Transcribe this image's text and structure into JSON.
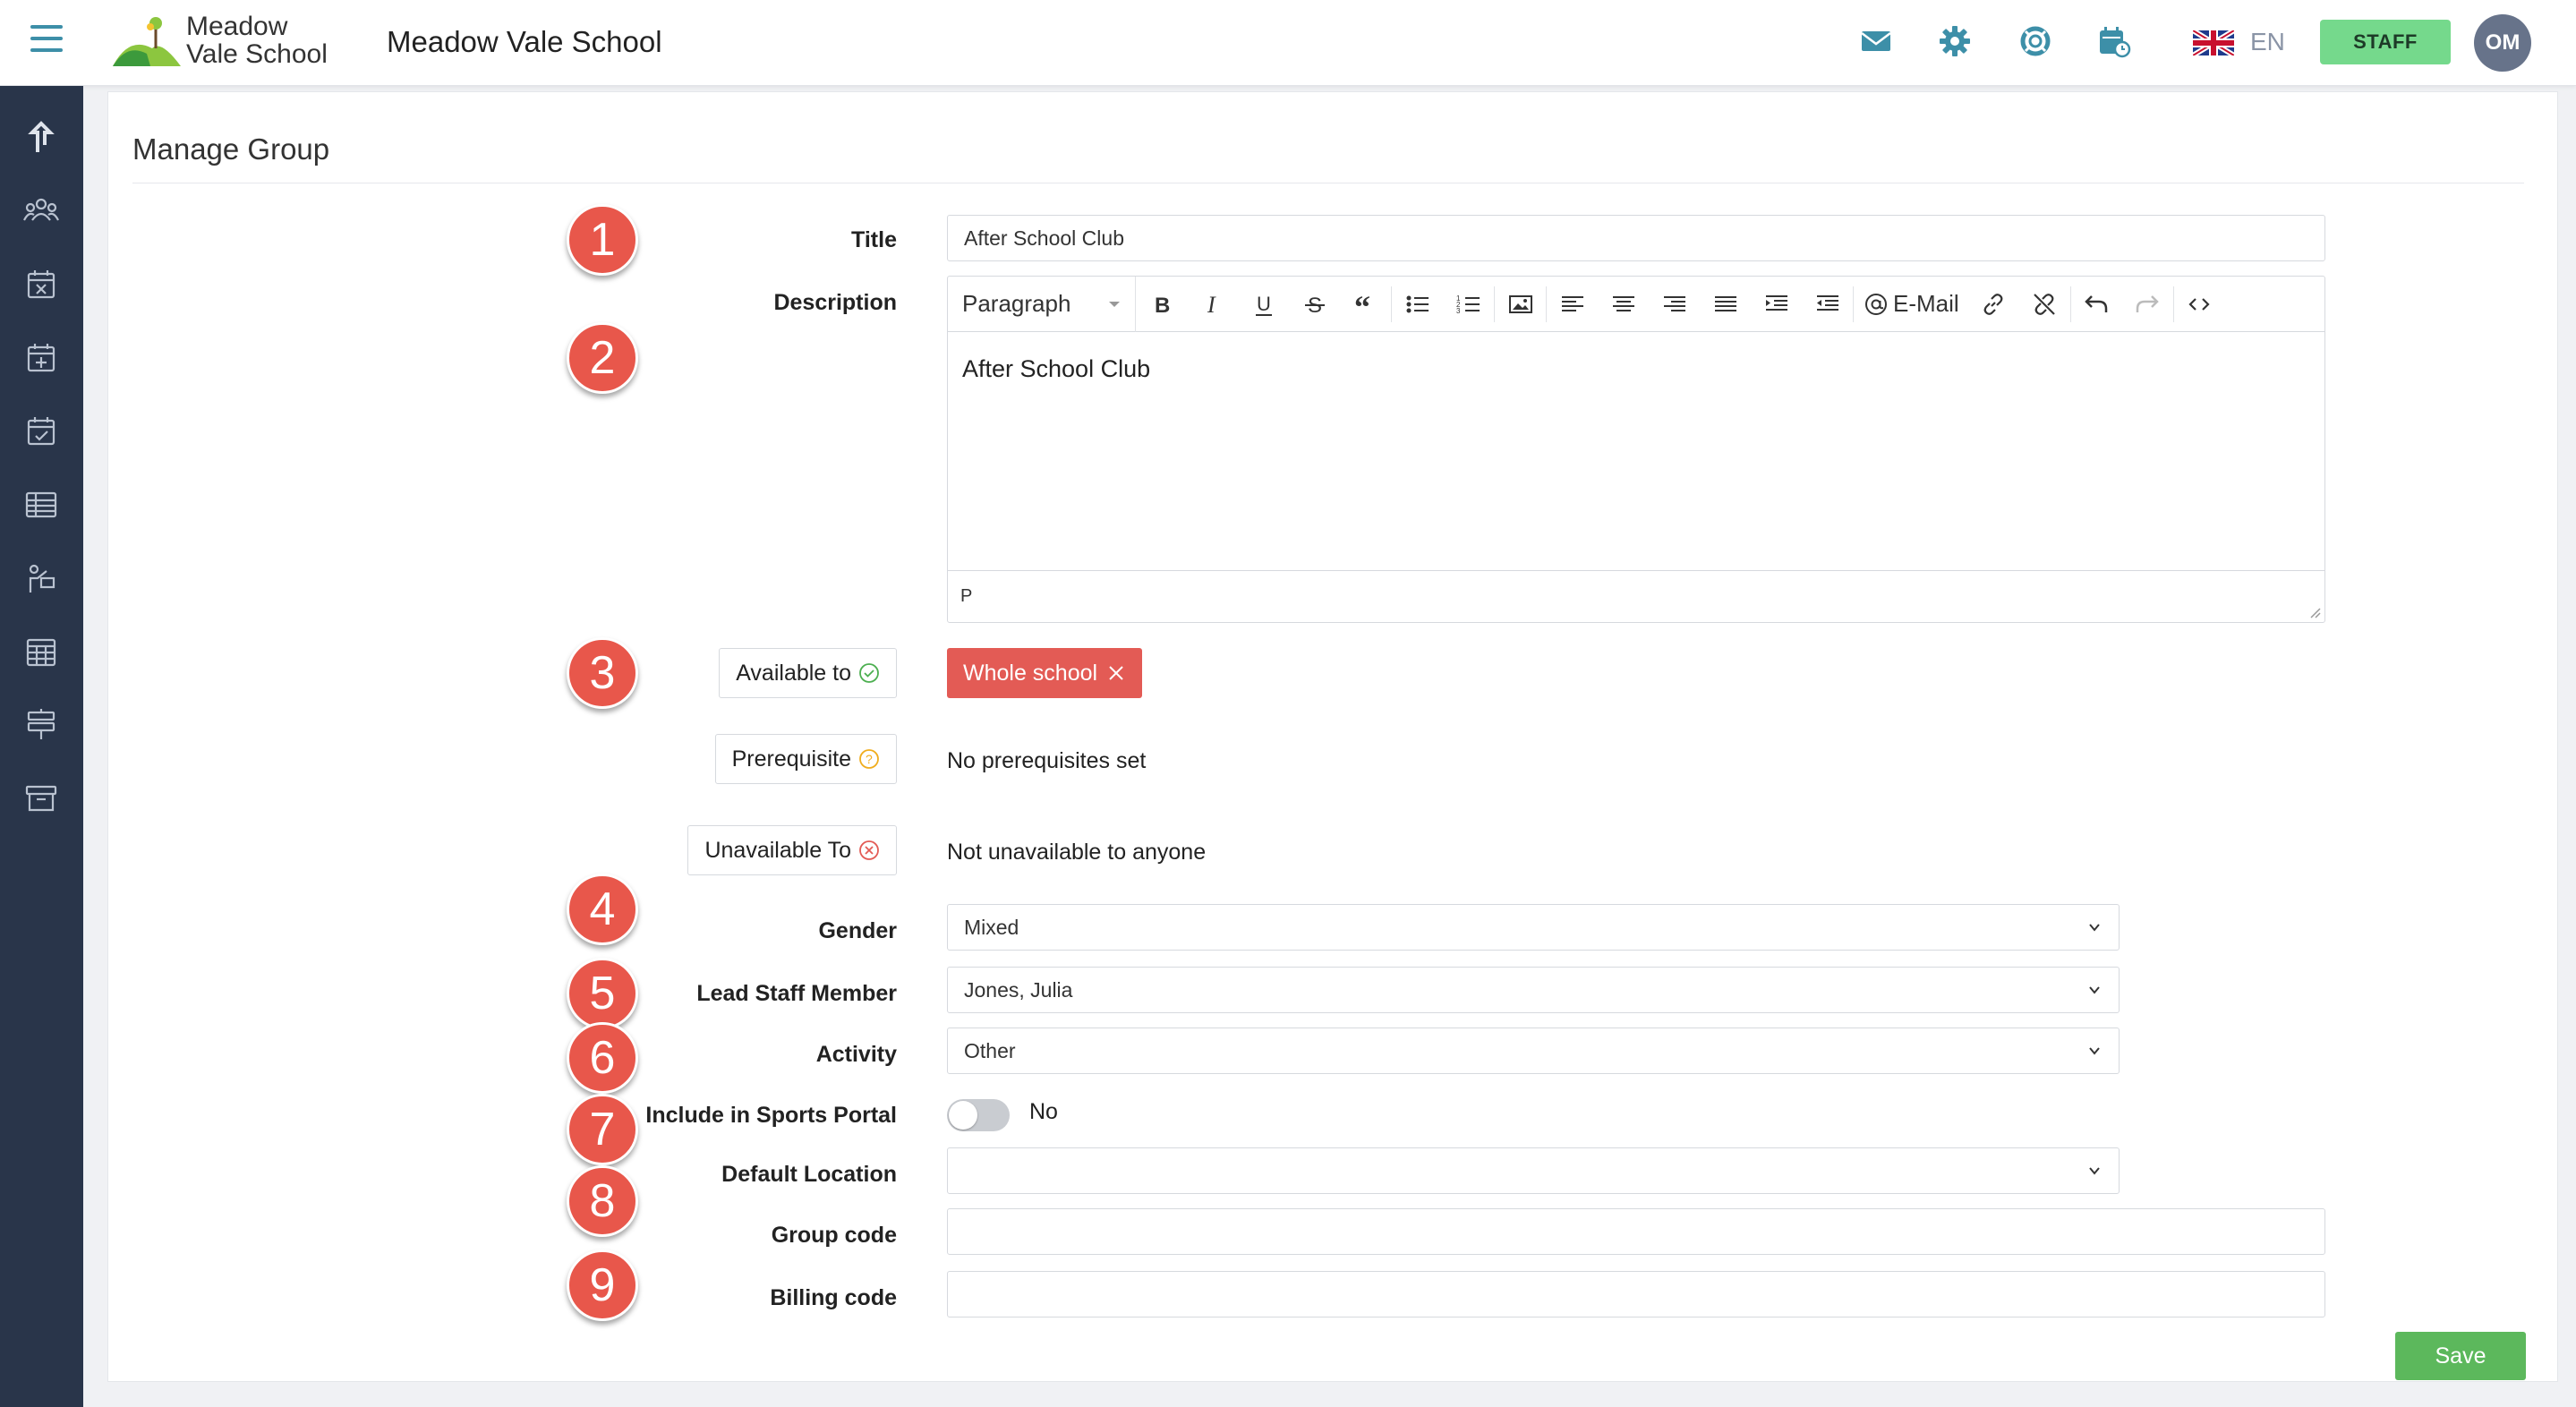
{
  "header": {
    "logo_line1": "Meadow",
    "logo_line2": "Vale School",
    "school_name": "Meadow Vale School",
    "language": "EN",
    "staff_label": "STAFF",
    "avatar_initials": "OM"
  },
  "page": {
    "title": "Manage Group"
  },
  "form": {
    "title_label": "Title",
    "title_value": "After School Club",
    "description_label": "Description",
    "editor": {
      "block_format": "Paragraph",
      "email_label": "E-Mail",
      "content": "After School Club",
      "status_path": "P"
    },
    "available_to_label": "Available to",
    "available_to_tag": "Whole school",
    "prerequisite_label": "Prerequisite",
    "prerequisite_value": "No prerequisites set",
    "unavailable_label": "Unavailable To",
    "unavailable_value": "Not unavailable to anyone",
    "gender_label": "Gender",
    "gender_value": "Mixed",
    "lead_staff_label": "Lead Staff Member",
    "lead_staff_value": "Jones, Julia",
    "activity_label": "Activity",
    "activity_value": "Other",
    "sports_portal_label": "Include in Sports Portal",
    "sports_portal_value": "No",
    "default_location_label": "Default Location",
    "default_location_value": "",
    "group_code_label": "Group code",
    "group_code_value": "",
    "billing_code_label": "Billing code",
    "billing_code_value": "",
    "save_label": "Save"
  },
  "markers": [
    "1",
    "2",
    "3",
    "4",
    "5",
    "6",
    "7",
    "8",
    "9"
  ],
  "colors": {
    "sidebar": "#29354a",
    "accent_teal": "#3d8fa8",
    "staff_green": "#75d98c",
    "marker_red": "#e8574b",
    "tag_red": "#e35b55",
    "save_green": "#5cb85c"
  }
}
